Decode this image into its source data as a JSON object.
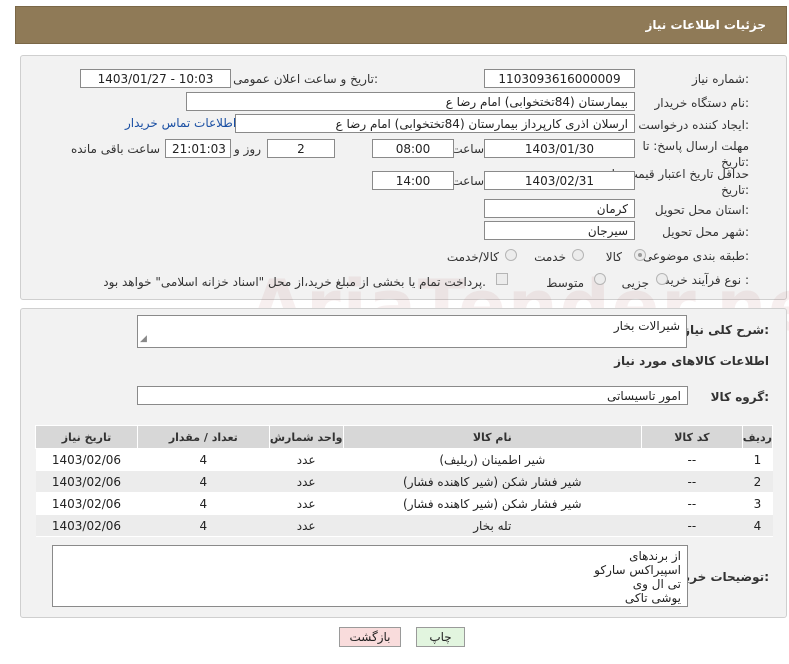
{
  "header": {
    "title": "جزئیات اطلاعات نیاز"
  },
  "watermark": "AriaTender.net",
  "fields": {
    "need_number_label": "شماره نیاز:",
    "need_number": "1103093616000009",
    "announce_label": "تاریخ و ساعت اعلان عمومی:",
    "announce_value": "1403/01/27 - 10:03",
    "buyer_org_label": "نام دستگاه خریدار:",
    "buyer_org": "بیمارستان (84تختخوابی) امام رضا  ع",
    "creator_label": "ایجاد کننده درخواست:",
    "creator": "ارسلان اذری کارپرداز بیمارستان (84تختخوابی) امام رضا  ع",
    "contact_link": "اطلاعات تماس خریدار",
    "reply_deadline_label": "مهلت ارسال پاسخ: تا تاریخ:",
    "reply_date": "1403/01/30",
    "time_label": "ساعت",
    "reply_time": "08:00",
    "days": "2",
    "days_label": "روز و",
    "remaining_time": "21:01:03",
    "remaining_label": "ساعت باقی مانده",
    "price_validity_label": "حداقل تاریخ اعتبار قیمت: تا تاریخ:",
    "price_date": "1403/02/31",
    "price_time": "14:00",
    "province_label": "استان محل تحویل:",
    "province": "کرمان",
    "city_label": "شهر محل تحویل:",
    "city": "سیرجان",
    "category_label": "طبقه بندی موضوعی:",
    "category_options": [
      "کالا",
      "خدمت",
      "کالا/خدمت"
    ],
    "category_selected": "کالا",
    "process_label": "نوع فرآیند خرید :",
    "process_options": [
      "جزیی",
      "متوسط"
    ],
    "payment_note": "پرداخت تمام یا بخشی از مبلغ خرید،از محل \"اسناد خزانه اسلامی\" خواهد بود."
  },
  "summary": {
    "label": "شرح کلی نیاز:",
    "value": "شیرالات بخار"
  },
  "goods": {
    "section_title": "اطلاعات کالاهای مورد نیاز",
    "group_label": "گروه کالا:",
    "group_value": "امور تاسیساتی",
    "columns": [
      "ردیف",
      "کد کالا",
      "نام کالا",
      "واحد شمارش",
      "تعداد / مقدار",
      "تاریخ نیاز"
    ],
    "rows": [
      [
        "1",
        "--",
        "شیر اطمینان (ریلیف)",
        "عدد",
        "4",
        "1403/02/06"
      ],
      [
        "2",
        "--",
        "شیر فشار شکن (شیر کاهنده فشار)",
        "عدد",
        "4",
        "1403/02/06"
      ],
      [
        "3",
        "--",
        "شیر فشار شکن (شیر کاهنده فشار)",
        "عدد",
        "4",
        "1403/02/06"
      ],
      [
        "4",
        "--",
        "تله بخار",
        "عدد",
        "4",
        "1403/02/06"
      ]
    ]
  },
  "buyer_notes": {
    "label": "توضیحات خریدار:",
    "lines": [
      "از برندهای",
      "اسپیراکس سارکو",
      "تی ال وی",
      "یوشی تاکی"
    ]
  },
  "buttons": {
    "print": "چاپ",
    "back": "بازگشت"
  }
}
